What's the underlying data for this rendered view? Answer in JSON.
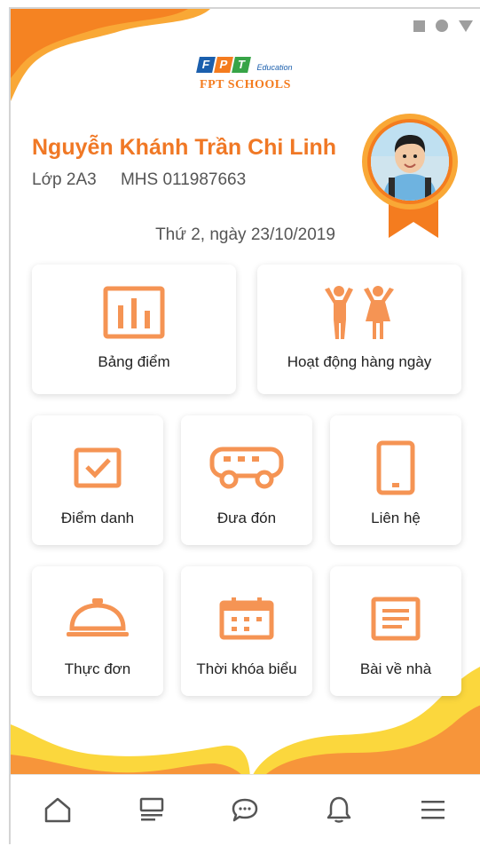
{
  "brand": {
    "logo_letters": [
      "F",
      "P",
      "T"
    ],
    "logo_colors": [
      "#1b5fad",
      "#f47c1f",
      "#37a447"
    ],
    "logo_sub": "Education",
    "school_name": "FPT SCHOOLS"
  },
  "student": {
    "name": "Nguyễn Khánh Trần Chi Linh",
    "class_label": "Lớp 2A3",
    "mhs_label": "MHS 011987663"
  },
  "date_text": "Thứ 2, ngày 23/10/2019",
  "menu": [
    {
      "label": "Bảng điểm",
      "icon": "bar-chart-icon"
    },
    {
      "label": "Hoạt động hàng ngày",
      "icon": "kids-activity-icon"
    },
    {
      "label": "Điểm danh",
      "icon": "checkbox-icon"
    },
    {
      "label": "Đưa đón",
      "icon": "bus-icon"
    },
    {
      "label": "Liên hệ",
      "icon": "phone-icon"
    },
    {
      "label": "Thực đơn",
      "icon": "food-cloche-icon"
    },
    {
      "label": "Thời khóa biểu",
      "icon": "calendar-icon"
    },
    {
      "label": "Bài về nhà",
      "icon": "homework-document-icon"
    }
  ],
  "bottom_nav": [
    {
      "icon": "home-icon"
    },
    {
      "icon": "news-feed-icon"
    },
    {
      "icon": "chat-icon"
    },
    {
      "icon": "notification-bell-icon"
    },
    {
      "icon": "hamburger-menu-icon"
    }
  ],
  "colors": {
    "accent": "#f47c1f",
    "accent_light": "#f9a836",
    "icon_orange": "#f59454",
    "wave_yellow": "#fbd73d",
    "wave_orange": "#f7953a"
  }
}
